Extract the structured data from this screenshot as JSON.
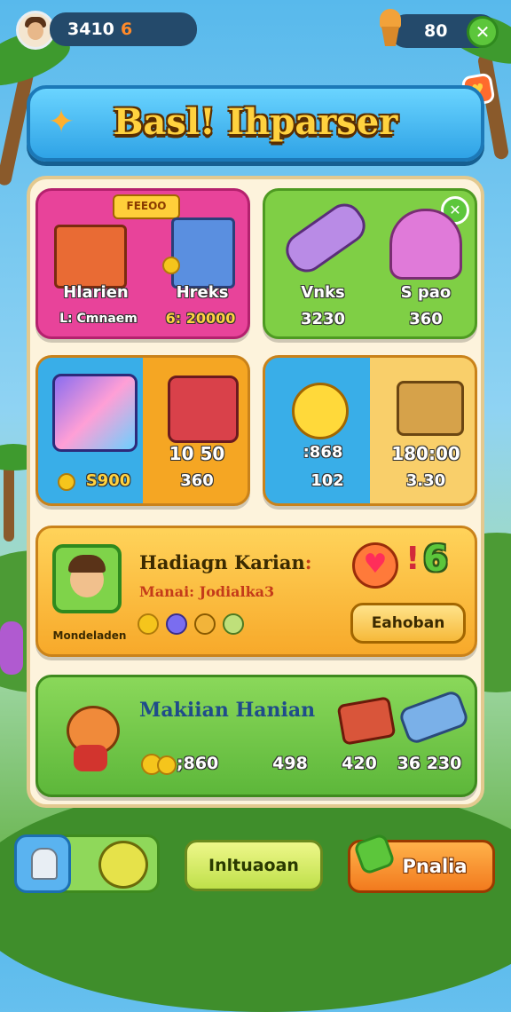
{
  "top_bar": {
    "player_score": "3410",
    "player_level": "6",
    "currency_value": "80"
  },
  "title": "Basl! Ihparser",
  "shop_cards": [
    {
      "badge": "FEEOO",
      "items": [
        {
          "name": "Hlarien",
          "price": "L: Cmnaem"
        },
        {
          "name": "Hreks",
          "price": "6: 20000"
        }
      ]
    },
    {
      "items": [
        {
          "name": "Vnks",
          "price": "3230"
        },
        {
          "name": "S pao",
          "price": "360"
        }
      ]
    },
    {
      "items": [
        {
          "name": "",
          "price": "S900"
        },
        {
          "name": "10 50",
          "price": "360"
        }
      ]
    },
    {
      "items": [
        {
          "name": ":868",
          "price": "102"
        },
        {
          "name": "180:00",
          "price": "3.30"
        }
      ]
    }
  ],
  "daily_reward": {
    "title": "Hadiagn Karian",
    "title_suffix": ":",
    "subtitle": "Manai: Jodialka3",
    "avatar_caption": "Mondeladen",
    "count": "6",
    "exclaim": "!",
    "button_label": "Eahoban"
  },
  "daily_meal": {
    "title": "Makiian Hanian",
    "values": [
      ";860",
      "498",
      "420",
      "36 230"
    ]
  },
  "bottom_nav": {
    "center_label": "Inltuaoan",
    "right_label": "Pnalia"
  },
  "colors": {
    "sky": "#58b9ec",
    "banner": "#2fa3e6",
    "title_text": "#ffd23f",
    "pink_card": "#e8439a",
    "green_card": "#7fcf45",
    "orange_card": "#f5a623",
    "blue_card": "#39aee8"
  }
}
